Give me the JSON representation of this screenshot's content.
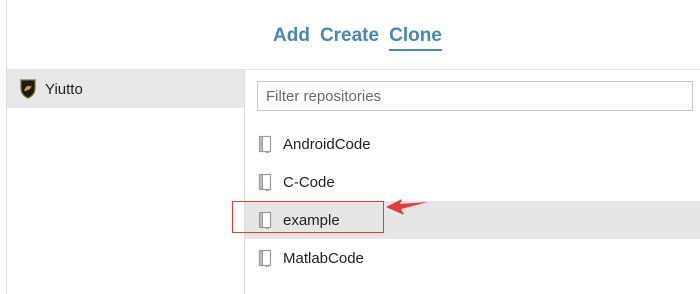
{
  "header": {
    "tabs": [
      {
        "label": "Add"
      },
      {
        "label": "Create"
      },
      {
        "label": "Clone"
      }
    ],
    "active_tab": "Clone"
  },
  "sidebar": {
    "account": {
      "name": "Yiutto",
      "icon": "lamborghini-logo-icon"
    }
  },
  "filter": {
    "placeholder": "Filter repositories",
    "value": ""
  },
  "repositories": [
    {
      "name": "AndroidCode",
      "icon": "repo-book-icon"
    },
    {
      "name": "C-Code",
      "icon": "repo-book-icon"
    },
    {
      "name": "example",
      "icon": "repo-book-icon",
      "selected": true
    },
    {
      "name": "MatlabCode",
      "icon": "repo-book-icon"
    }
  ],
  "annotation": {
    "color": "#e13b3b"
  },
  "colors": {
    "accent": "#4a86b8",
    "selected_bg": "#e6e6e6",
    "sidebar_selected_bg": "#e8e8e8"
  }
}
